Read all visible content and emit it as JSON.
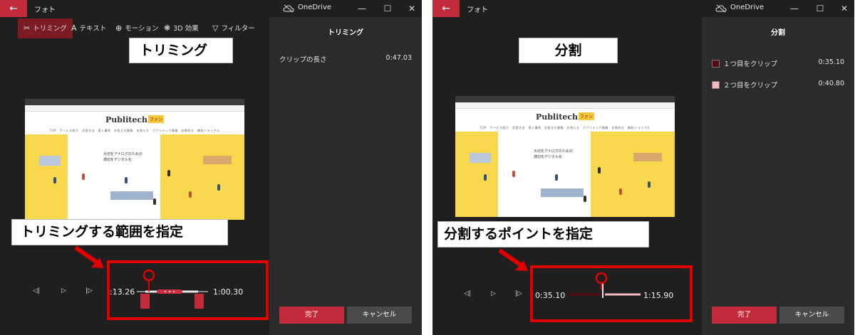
{
  "common": {
    "back_glyph": "←",
    "app_name": "フォト",
    "onedrive": "OneDrive",
    "minimize": "—",
    "maximize": "☐",
    "close": "✕",
    "prev_frame": "◁|",
    "play": "▷",
    "next_frame": "|▷",
    "video": {
      "brand": "Publitech",
      "brand_tag": "ファン",
      "nav": "TOP　サービス紹介　活用方法　導入事例　お役立ち情報　お知らせ　パブリテック情報　お問合せ　無料トライアル",
      "hero_copy_1": "大切をアナログのための",
      "hero_copy_2": "適切をデジタル化"
    },
    "colors": {
      "accent": "#c42b3a",
      "clip1": "#5a0a12",
      "clip2": "#f5b8bd",
      "highlight": "#e10000"
    }
  },
  "trim": {
    "tools": [
      {
        "icon": "✂",
        "label": "トリミング",
        "active": true
      },
      {
        "icon": "A",
        "label": "テキスト",
        "active": false
      },
      {
        "icon": "⊕",
        "label": "モーション",
        "active": false
      },
      {
        "icon": "❋",
        "label": "3D 効果",
        "active": false
      },
      {
        "icon": "▽",
        "label": "フィルター",
        "active": false
      }
    ],
    "callout_title": "トリミング",
    "callout_range": "トリミングする範囲を指定",
    "start_time": ":13.26",
    "end_time": "1:00.30",
    "panel_title": "トリミング",
    "clip_length_label": "クリップの長さ",
    "clip_length_value": "0:47.03",
    "done": "完了",
    "cancel": "キャンセル"
  },
  "split": {
    "callout_title": "分割",
    "callout_point": "分割するポイントを指定",
    "start_time": "0:35.10",
    "end_time": "1:15.90",
    "panel_title": "分割",
    "clip1_label": "１つ目をクリップ",
    "clip1_value": "0:35.10",
    "clip2_label": "２つ目をクリップ",
    "clip2_value": "0:40.80",
    "done": "完了",
    "cancel": "キャンセル"
  }
}
